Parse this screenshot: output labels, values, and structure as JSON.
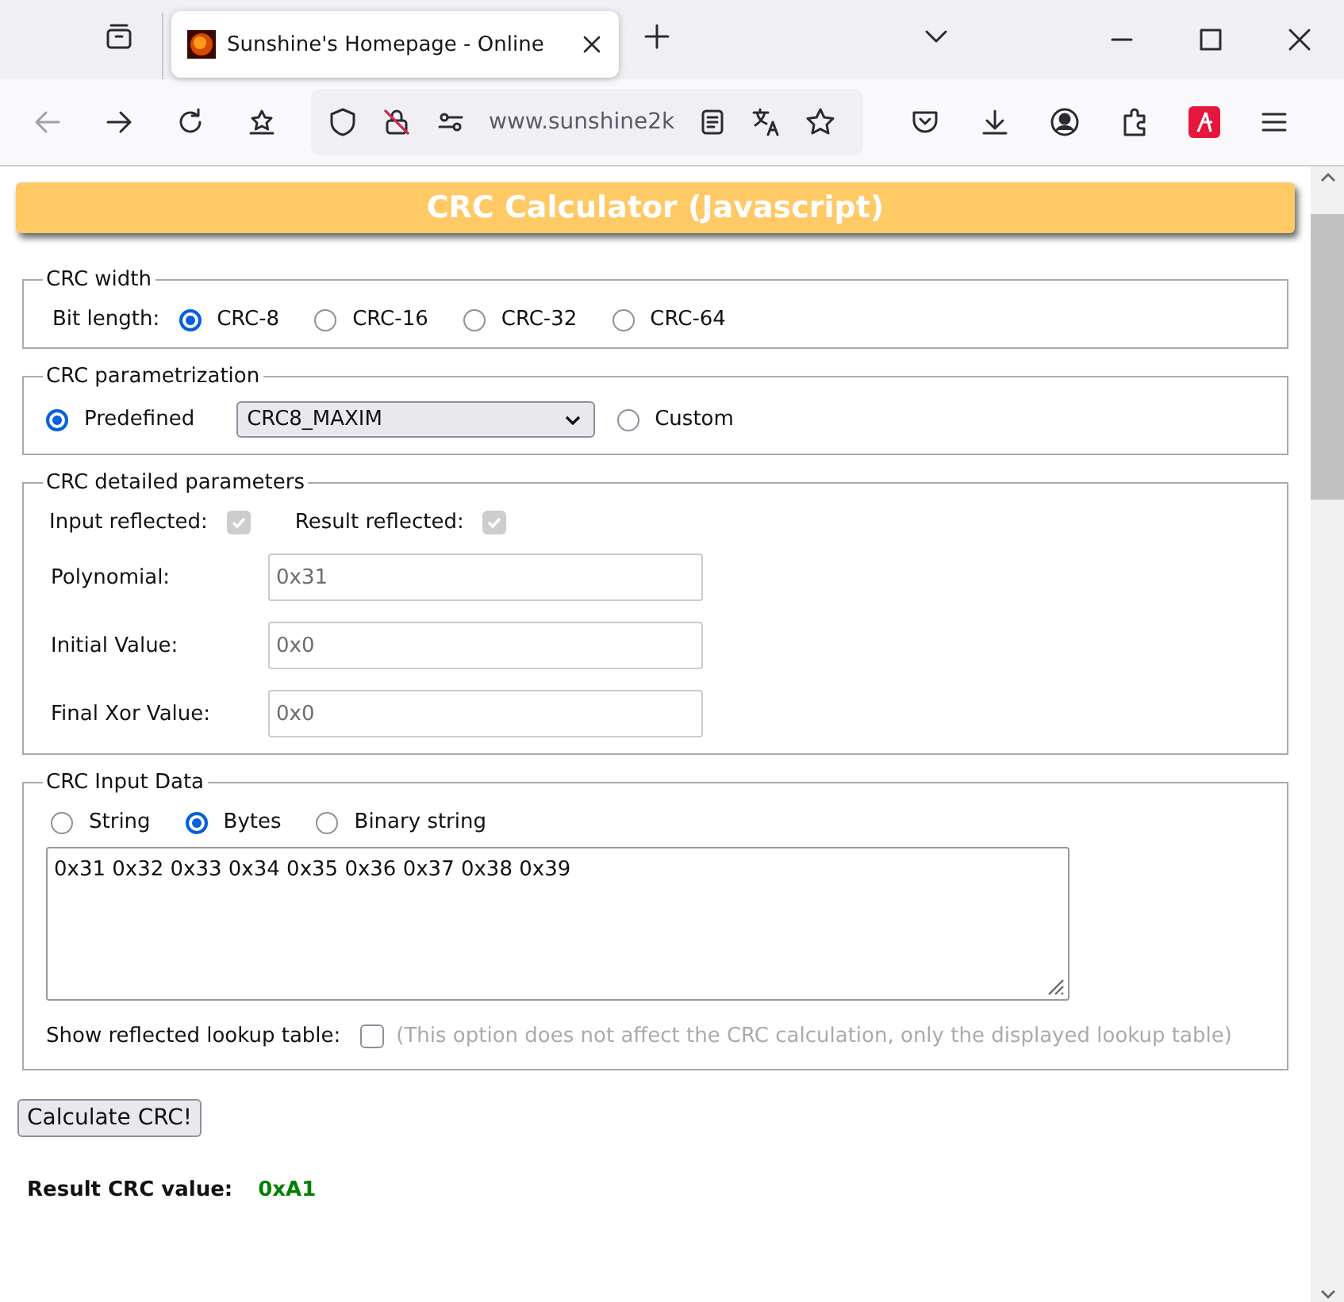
{
  "browser": {
    "tab": {
      "title": "Sunshine's Homepage - Online",
      "selected": true
    },
    "address": "www.sunshine2k"
  },
  "page": {
    "title": "CRC Calculator (Javascript)",
    "width": {
      "legend": "CRC width",
      "label": "Bit length:",
      "options": [
        {
          "label": "CRC-8",
          "selected": true
        },
        {
          "label": "CRC-16",
          "selected": false
        },
        {
          "label": "CRC-32",
          "selected": false
        },
        {
          "label": "CRC-64",
          "selected": false
        }
      ]
    },
    "parametrization": {
      "legend": "CRC parametrization",
      "options": [
        {
          "label": "Predefined",
          "selected": true
        },
        {
          "label": "Custom",
          "selected": false
        }
      ],
      "preset": "CRC8_MAXIM"
    },
    "detailed": {
      "legend": "CRC detailed parameters",
      "checks": [
        {
          "label": "Input reflected:",
          "checked": true,
          "disabled": true
        },
        {
          "label": "Result reflected:",
          "checked": true,
          "disabled": true
        }
      ],
      "fields": [
        {
          "label": "Polynomial:",
          "value": "0x31",
          "disabled": true
        },
        {
          "label": "Initial Value:",
          "value": "0x0",
          "disabled": true
        },
        {
          "label": "Final Xor Value:",
          "value": "0x0",
          "disabled": true
        }
      ]
    },
    "input": {
      "legend": "CRC Input Data",
      "formats": [
        {
          "label": "String",
          "selected": false
        },
        {
          "label": "Bytes",
          "selected": true
        },
        {
          "label": "Binary string",
          "selected": false
        }
      ],
      "data": "0x31 0x32 0x33 0x34 0x35 0x36 0x37 0x38 0x39",
      "lookup": {
        "label": "Show reflected lookup table:",
        "checked": false,
        "note": "(This option does not affect the CRC calculation, only the displayed lookup table)"
      }
    },
    "button": "Calculate CRC!",
    "result": {
      "label": "Result CRC value:",
      "value": "0xA1"
    }
  }
}
